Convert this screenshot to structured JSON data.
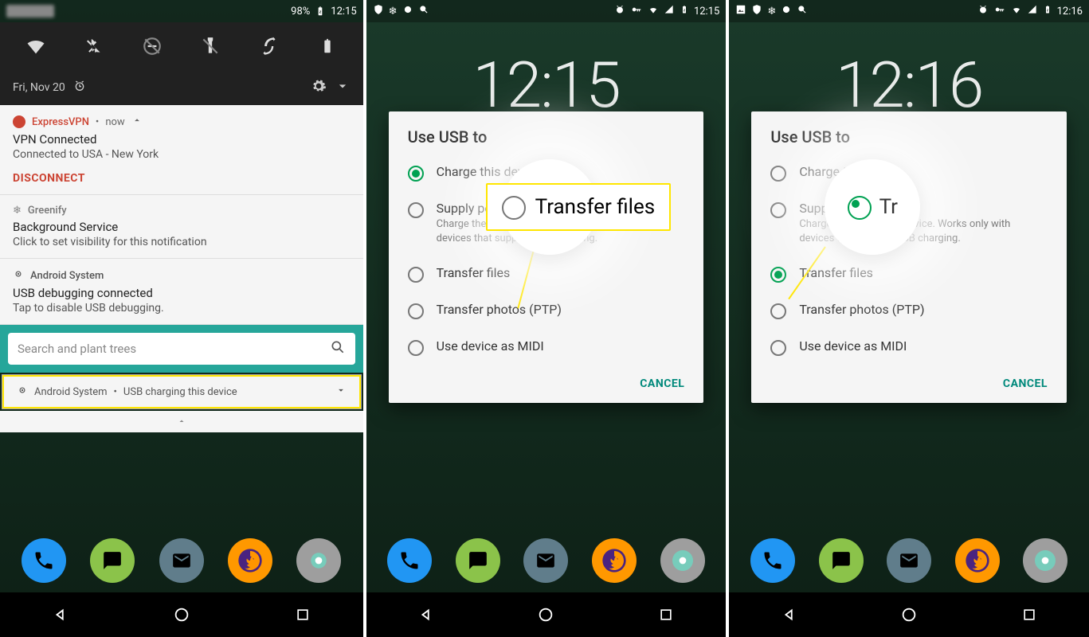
{
  "panel1": {
    "status": {
      "battery": "98%",
      "time": "12:15"
    },
    "date": "Fri, Nov 20",
    "notifications": {
      "vpn": {
        "app": "ExpressVPN",
        "when": "now",
        "title": "VPN Connected",
        "body": "Connected to USA - New York",
        "action": "DISCONNECT"
      },
      "greenify": {
        "app": "Greenify",
        "title": "Background Service",
        "body": "Click to set visibility for this notification"
      },
      "debug": {
        "app": "Android System",
        "title": "USB debugging connected",
        "body": "Tap to disable USB debugging."
      },
      "search_placeholder": "Search and plant trees",
      "usb": {
        "app": "Android System",
        "text": "USB charging this device"
      }
    }
  },
  "panel2": {
    "status": {
      "time": "12:15"
    },
    "clock": "12:15",
    "dialog": {
      "title": "Use USB to",
      "options": [
        {
          "label": "Charge this device",
          "checked": true
        },
        {
          "label": "Supply power",
          "sub": "Charge the connected device. Works only with devices that support USB charging."
        },
        {
          "label": "Transfer files"
        },
        {
          "label": "Transfer photos (PTP)"
        },
        {
          "label": "Use device as MIDI"
        }
      ],
      "cancel": "CANCEL"
    },
    "callout": "Transfer files"
  },
  "panel3": {
    "status": {
      "time": "12:16"
    },
    "clock": "12:16",
    "dialog": {
      "title": "Use USB to",
      "options": [
        {
          "label": "Charge this device"
        },
        {
          "label": "Supply power",
          "sub": "Charge the connected device. Works only with devices that support USB charging."
        },
        {
          "label": "Transfer files",
          "checked": true
        },
        {
          "label": "Transfer photos (PTP)"
        },
        {
          "label": "Use device as MIDI"
        }
      ],
      "cancel": "CANCEL"
    },
    "callout": "Tr"
  }
}
